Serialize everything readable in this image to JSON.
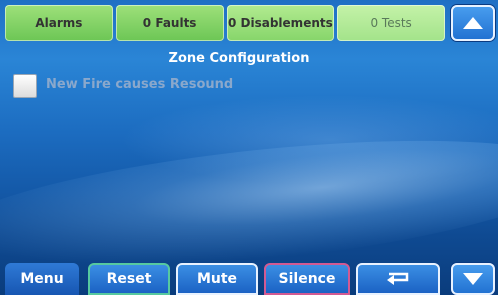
{
  "status_bar": {
    "alarms": "Alarms",
    "faults": "0 Faults",
    "disablements": "0 Disablements",
    "tests": "0 Tests"
  },
  "page": {
    "title": "Zone Configuration"
  },
  "options": [
    {
      "label": "New Fire causes Resound",
      "checked": false
    }
  ],
  "commands": {
    "menu": "Menu",
    "reset": "Reset",
    "mute": "Mute",
    "silence": "Silence",
    "enter_icon": "return-arrow-icon"
  },
  "navigation": {
    "up_icon": "arrow-up-icon",
    "down_icon": "arrow-down-icon"
  },
  "colors": {
    "status_green": "#6cc655",
    "background_blue": "#1f6fc4",
    "reset_border": "#56c9a0",
    "silence_border": "#d25a93"
  }
}
